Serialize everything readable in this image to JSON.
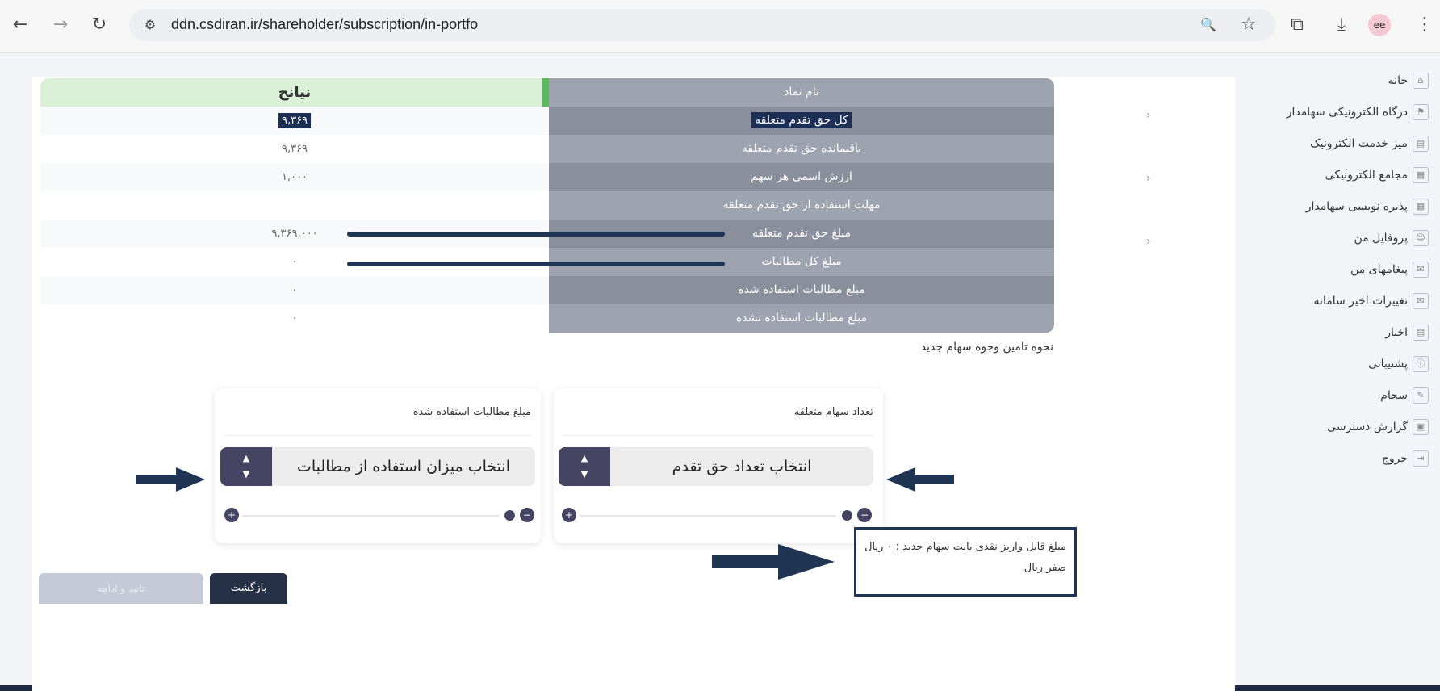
{
  "browser": {
    "url": "ddn.csdiran.ir/shareholder/subscription/in-portfo",
    "back_glyph": "←",
    "forward_glyph": "→",
    "reload_glyph": "↻",
    "site_info_glyph": "⚙",
    "zoom_glyph": "🔍",
    "star_glyph": "☆",
    "extensions_glyph": "⧉",
    "download_glyph": "⤓",
    "menu_glyph": "⋮",
    "avatar_glyph": "ee"
  },
  "sidebar": {
    "items": [
      {
        "label": "خانه",
        "icon": "home-icon",
        "glyph": "⌂",
        "chevron": false
      },
      {
        "label": "درگاه الکترونیکی سهامدار",
        "icon": "portal-icon",
        "glyph": "⚑",
        "chevron": true
      },
      {
        "label": "میز خدمت الکترونیک",
        "icon": "desk-icon",
        "glyph": "▤",
        "chevron": false
      },
      {
        "label": "مجامع الکترونیکی",
        "icon": "assembly-icon",
        "glyph": "▦",
        "chevron": true
      },
      {
        "label": "پذیره نویسی سهامدار",
        "icon": "subscription-icon",
        "glyph": "▦",
        "chevron": false
      },
      {
        "label": "پروفایل من",
        "icon": "profile-icon",
        "glyph": "☺",
        "chevron": true
      },
      {
        "label": "پیغامهای من",
        "icon": "mail-icon",
        "glyph": "✉",
        "chevron": false
      },
      {
        "label": "تغییرات اخیر سامانه",
        "icon": "changes-icon",
        "glyph": "✉",
        "chevron": false
      },
      {
        "label": "اخبار",
        "icon": "news-icon",
        "glyph": "▤",
        "chevron": false
      },
      {
        "label": "پشتیبانی",
        "icon": "support-icon",
        "glyph": "ⓘ",
        "chevron": false
      },
      {
        "label": "سجام",
        "icon": "sejam-icon",
        "glyph": "✎",
        "chevron": false
      },
      {
        "label": "گزارش دسترسی",
        "icon": "report-icon",
        "glyph": "▣",
        "chevron": false
      },
      {
        "label": "خروج",
        "icon": "logout-icon",
        "glyph": "⇥",
        "chevron": false
      }
    ]
  },
  "info_table": {
    "symbol_header": "نام نماد",
    "symbol_value": "نیانح",
    "rows": [
      {
        "label": "کل حق تقدم متعلقه",
        "value": "۹,۳۶۹",
        "highlight": true
      },
      {
        "label": "باقیمانده حق تقدم متعلقه",
        "value": "۹,۳۶۹",
        "highlight": false
      },
      {
        "label": "ارزش اسمی هر سهم",
        "value": "۱,۰۰۰",
        "highlight": false
      },
      {
        "label": "مهلت استفاده از حق تقدم متعلقه",
        "value": "",
        "highlight": false
      },
      {
        "label": "مبلغ حق تقدم متعلقه",
        "value": "۹,۳۶۹,۰۰۰",
        "highlight": false
      },
      {
        "label": "مبلغ کل مطالبات",
        "value": "۰",
        "highlight": false
      },
      {
        "label": "مبلغ مطالبات استفاده شده",
        "value": "۰",
        "highlight": false
      },
      {
        "label": "مبلغ مطالبات استفاده نشده",
        "value": "۰",
        "highlight": false
      }
    ]
  },
  "funding": {
    "title": "نحوه تامین وجوه سهام جدید",
    "shares_card": {
      "title": "تعداد سهام متعلقه",
      "select_text": "انتخاب تعداد حق تقدم",
      "up_glyph": "▲",
      "down_glyph": "▼",
      "plus_glyph": "+",
      "minus_glyph": "−"
    },
    "claims_card": {
      "title": "مبلغ مطالبات استفاده شده",
      "select_text": "انتخاب میزان استفاده از مطالبات",
      "up_glyph": "▲",
      "down_glyph": "▼",
      "plus_glyph": "+",
      "minus_glyph": "−"
    }
  },
  "payment": {
    "line1": "مبلغ قابل واریز نقدی بابت سهام جدید : ۰ ریال",
    "line2": "صفر ریال"
  },
  "actions": {
    "back_label": "بازگشت",
    "confirm_label": "تایید و ادامه"
  },
  "colors": {
    "annotation": "#1f3553",
    "stepper": "#454563",
    "header_green": "#daf0d7"
  }
}
